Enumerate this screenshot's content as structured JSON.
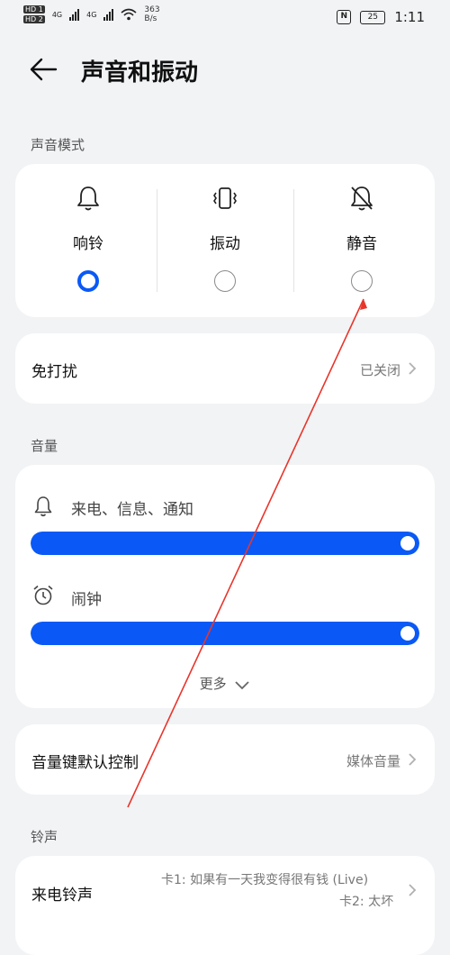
{
  "status_bar": {
    "sim1_tag": "HD 1",
    "sim2_tag": "HD 2",
    "sim1_net": "4G",
    "sim2_net": "4G",
    "net_speed_value": "363",
    "net_speed_unit": "B/s",
    "nfc": "N",
    "battery": "25",
    "time": "1:11"
  },
  "header": {
    "title": "声音和振动"
  },
  "sound_mode": {
    "section_label": "声音模式",
    "options": [
      {
        "label": "响铃",
        "icon": "bell-icon",
        "selected": true
      },
      {
        "label": "振动",
        "icon": "vibrate-icon",
        "selected": false
      },
      {
        "label": "静音",
        "icon": "bell-muted-icon",
        "selected": false
      }
    ]
  },
  "do_not_disturb": {
    "label": "免打扰",
    "value": "已关闭"
  },
  "volume": {
    "section_label": "音量",
    "sliders": [
      {
        "label": "来电、信息、通知",
        "icon": "bell-icon",
        "level": 1.0
      },
      {
        "label": "闹钟",
        "icon": "alarm-clock-icon",
        "level": 1.0
      }
    ],
    "more_label": "更多"
  },
  "volume_key": {
    "label": "音量键默认控制",
    "value": "媒体音量"
  },
  "ringtone": {
    "section_label": "铃声",
    "label": "来电铃声",
    "value_card1": "卡1: 如果有一天我变得很有钱 (Live)",
    "value_card2": "卡2: 太坏"
  },
  "colors": {
    "accent": "#0a59f7",
    "annotation_line": "#e8352b"
  }
}
